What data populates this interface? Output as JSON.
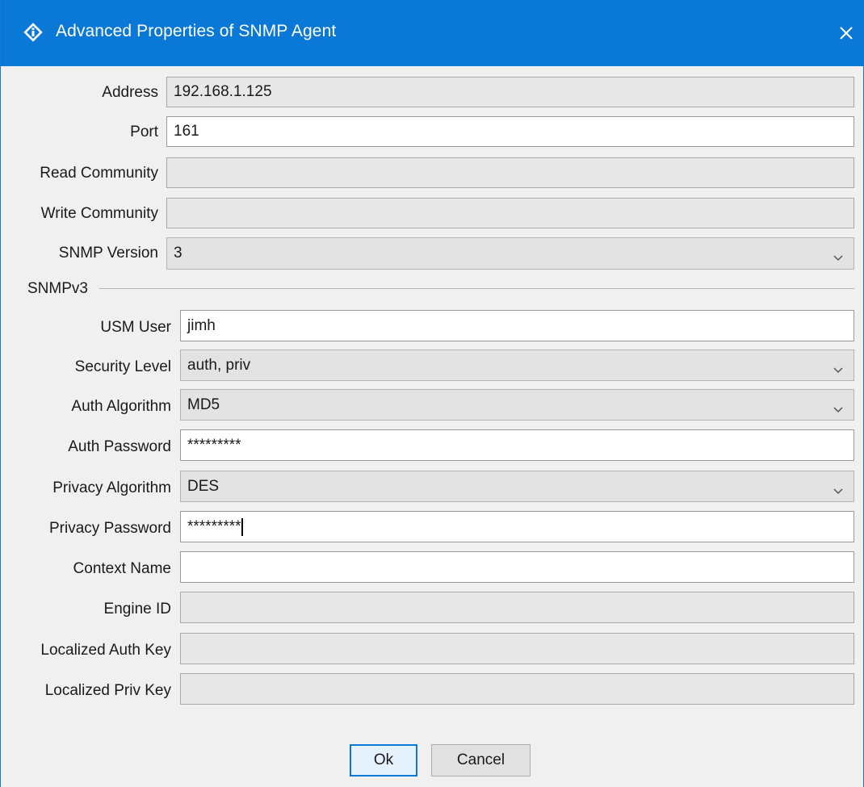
{
  "window": {
    "title": "Advanced Properties of SNMP Agent",
    "accent_color": "#0a78d7",
    "app_icon": "info-diamond-icon",
    "close_icon": "close-icon"
  },
  "fields": {
    "address": {
      "label": "Address",
      "value": "192.168.1.125"
    },
    "port": {
      "label": "Port",
      "value": "161"
    },
    "read_community": {
      "label": "Read Community",
      "value": ""
    },
    "write_community": {
      "label": "Write Community",
      "value": ""
    },
    "snmp_version": {
      "label": "SNMP Version",
      "value": "3"
    }
  },
  "snmpv3": {
    "section_label": "SNMPv3",
    "usm_user": {
      "label": "USM User",
      "value": "jimh"
    },
    "security_level": {
      "label": "Security Level",
      "value": "auth, priv"
    },
    "auth_algorithm": {
      "label": "Auth Algorithm",
      "value": "MD5"
    },
    "auth_password": {
      "label": "Auth Password",
      "value": "*********"
    },
    "privacy_algorithm": {
      "label": "Privacy Algorithm",
      "value": "DES"
    },
    "privacy_password": {
      "label": "Privacy Password",
      "value": "*********"
    },
    "context_name": {
      "label": "Context Name",
      "value": ""
    },
    "engine_id": {
      "label": "Engine ID",
      "value": ""
    },
    "localized_auth_key": {
      "label": "Localized Auth Key",
      "value": ""
    },
    "localized_priv_key": {
      "label": "Localized Priv Key",
      "value": ""
    }
  },
  "buttons": {
    "ok": "Ok",
    "cancel": "Cancel"
  }
}
